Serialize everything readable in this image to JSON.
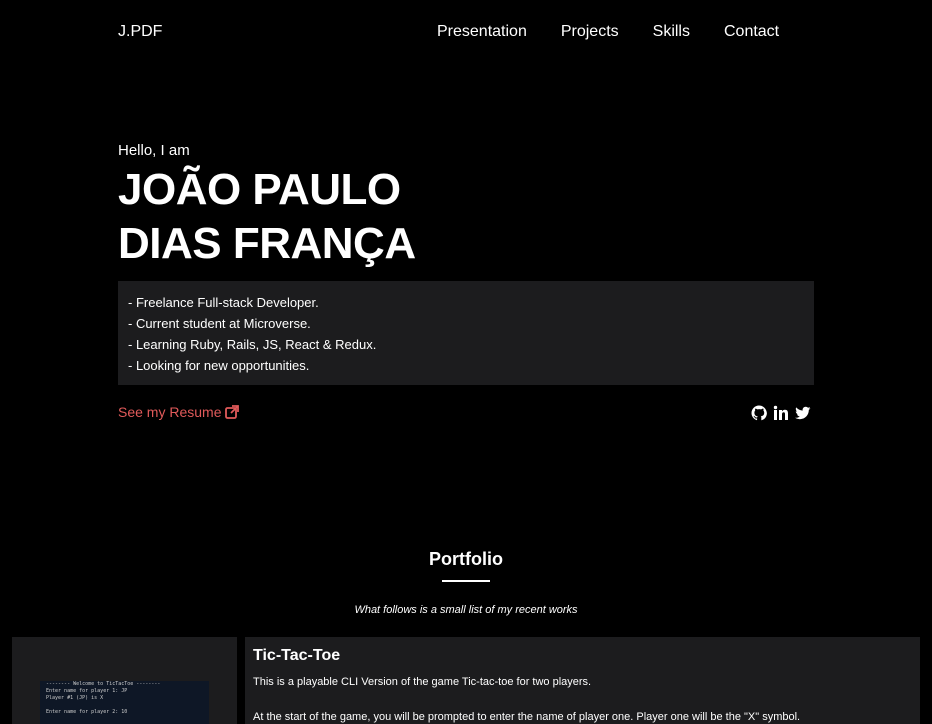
{
  "brand": "J.PDF",
  "nav": [
    "Presentation",
    "Projects",
    "Skills",
    "Contact"
  ],
  "hero": {
    "greeting": "Hello, I am",
    "name_line1": "JOÃO PAULO",
    "name_line2": "DIAS FRANÇA",
    "bio": [
      "- Freelance Full-stack Developer.",
      "- Current student at Microverse.",
      "- Learning Ruby, Rails, JS, React & Redux.",
      "- Looking for new opportunities."
    ],
    "resume_label": "See my Resume",
    "socials": [
      "github-icon",
      "linkedin-icon",
      "twitter-icon"
    ]
  },
  "portfolio": {
    "title": "Portfolio",
    "subtitle": "What follows is a small list of my recent works"
  },
  "project": {
    "title": "Tic-Tac-Toe",
    "description": "This is a playable CLI Version of the game Tic-tac-toe for two players.",
    "description2": "At the start of the game, you will be prompted to enter the name of player one. Player one will be the \"X\" symbol.",
    "thumb_lines": [
      "-------- Welcome to TicTacToe --------",
      "Enter name for player 1: JP",
      "Player #1 (JP) is X",
      "",
      "Enter name for player 2: 10"
    ]
  },
  "colors": {
    "accent": "#e05a5a",
    "panel": "#1c1c1e",
    "background": "#000000"
  }
}
